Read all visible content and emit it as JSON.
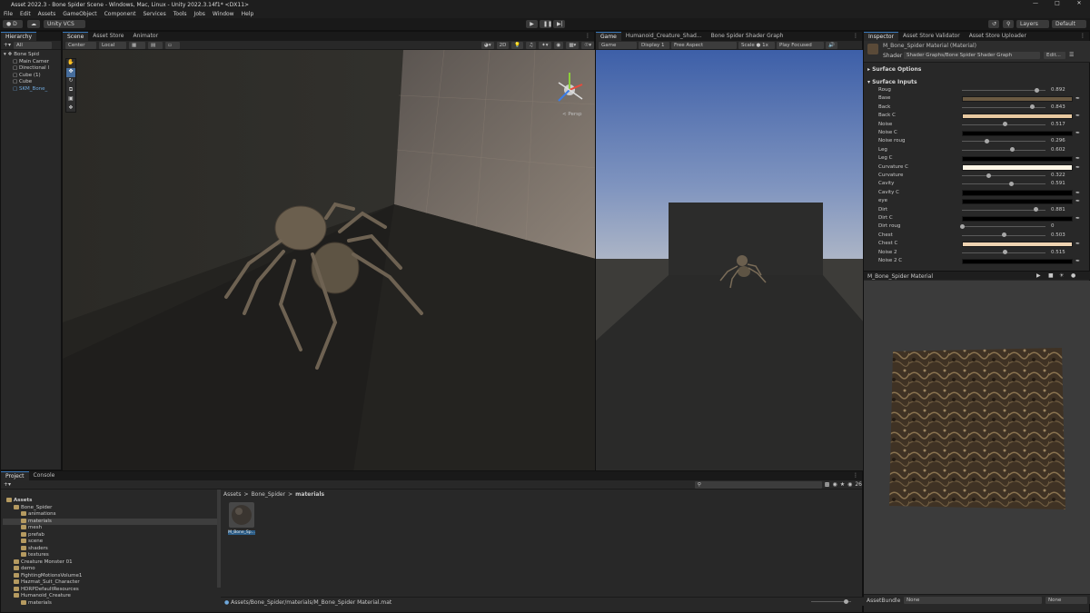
{
  "window": {
    "title": "Asset 2022.3 - Bone Spider Scene - Windows, Mac, Linux - Unity 2022.3.14f1* <DX11>"
  },
  "menu": [
    "File",
    "Edit",
    "Assets",
    "GameObject",
    "Component",
    "Services",
    "Tools",
    "Jobs",
    "Window",
    "Help"
  ],
  "toolbar": {
    "account": "D",
    "vcs": "Unity VCS",
    "layers": "Layers",
    "layout": "Default"
  },
  "hierarchy": {
    "tab": "Hierarchy",
    "search": "All",
    "items": [
      {
        "label": "Bone Spid",
        "indent": 0
      },
      {
        "label": "Main Camer",
        "indent": 1
      },
      {
        "label": "Directional l",
        "indent": 1
      },
      {
        "label": "Cube (1)",
        "indent": 1
      },
      {
        "label": "Cube",
        "indent": 1
      },
      {
        "label": "SKM_Bone_",
        "indent": 1
      }
    ]
  },
  "scene": {
    "tabs": [
      "Scene",
      "Asset Store",
      "Animator"
    ],
    "pivot": "Center",
    "space": "Local",
    "persp": "< Persp"
  },
  "game": {
    "tabs": [
      "Game",
      "Humanoid_Creature_Shad...",
      "Bone Spider Shader Graph"
    ],
    "mode": "Game",
    "display": "Display 1",
    "aspect": "Free Aspect",
    "scale_label": "Scale",
    "scale": "1x",
    "play": "Play Focused"
  },
  "inspector": {
    "tabs": [
      "Inspector",
      "Asset Store Validator",
      "Asset Store Uploader"
    ],
    "material_name": "M_Bone_Spider Material (Material)",
    "shader_label": "Shader",
    "shader": "Shader Graphs/Bone Spider Shader Graph",
    "edit": "Edit...",
    "section_options": "Surface Options",
    "section_inputs": "Surface Inputs",
    "props": [
      {
        "label": "Roug",
        "type": "slider",
        "value": "0.892",
        "fraction": 0.892
      },
      {
        "label": "Base",
        "type": "color",
        "color": "#6b5a42"
      },
      {
        "label": "Back",
        "type": "slider",
        "value": "0.843",
        "fraction": 0.843
      },
      {
        "label": "Back C",
        "type": "color",
        "color": "#e8c9a0"
      },
      {
        "label": "Noise",
        "type": "slider",
        "value": "0.517",
        "fraction": 0.517
      },
      {
        "label": "Noise C",
        "type": "color",
        "color": "#000000"
      },
      {
        "label": "Noise roug",
        "type": "slider",
        "value": "0.296",
        "fraction": 0.296
      },
      {
        "label": "Leg",
        "type": "slider",
        "value": "0.602",
        "fraction": 0.602
      },
      {
        "label": "Leg C",
        "type": "color",
        "color": "#000000"
      },
      {
        "label": "Curvature C",
        "type": "color",
        "color": "#fff6e6"
      },
      {
        "label": "Curvature",
        "type": "slider",
        "value": "0.322",
        "fraction": 0.322
      },
      {
        "label": "Cavity",
        "type": "slider",
        "value": "0.591",
        "fraction": 0.591
      },
      {
        "label": "Cavity C",
        "type": "color",
        "color": "#000000"
      },
      {
        "label": "eye",
        "type": "color",
        "color": "#000000"
      },
      {
        "label": "Dirt",
        "type": "slider",
        "value": "0.881",
        "fraction": 0.881
      },
      {
        "label": "Dirt C",
        "type": "color",
        "color": "#000000"
      },
      {
        "label": "Dirt roug",
        "type": "slider",
        "value": "0",
        "fraction": 0
      },
      {
        "label": "Chest",
        "type": "slider",
        "value": "0.503",
        "fraction": 0.503
      },
      {
        "label": "Chest C",
        "type": "color",
        "color": "#efd4b2"
      },
      {
        "label": "Noise 2",
        "type": "slider",
        "value": "0.515",
        "fraction": 0.515
      },
      {
        "label": "Noise 2 C",
        "type": "color",
        "color": "#000000"
      }
    ],
    "preview_title": "M_Bone_Spider Material",
    "assetbundle_label": "AssetBundle",
    "assetbundle": "None",
    "variant": "None"
  },
  "project": {
    "tabs": [
      "Project",
      "Console"
    ],
    "tree": [
      {
        "label": "Assets",
        "indent": 0,
        "bold": true
      },
      {
        "label": "Bone_Spider",
        "indent": 1
      },
      {
        "label": "animations",
        "indent": 2
      },
      {
        "label": "materials",
        "indent": 2,
        "selected": true
      },
      {
        "label": "mesh",
        "indent": 2
      },
      {
        "label": "prefab",
        "indent": 2
      },
      {
        "label": "scene",
        "indent": 2
      },
      {
        "label": "shaders",
        "indent": 2
      },
      {
        "label": "textures",
        "indent": 2
      },
      {
        "label": "Creature Monster 01",
        "indent": 1
      },
      {
        "label": "demo",
        "indent": 1
      },
      {
        "label": "FightingMotionsVolume1",
        "indent": 1
      },
      {
        "label": "Hazmat_Suit_Character",
        "indent": 1
      },
      {
        "label": "HDRPDefaultResources",
        "indent": 1
      },
      {
        "label": "Humanoid_Creature",
        "indent": 1
      },
      {
        "label": "materials",
        "indent": 2
      }
    ],
    "breadcrumb": [
      "Assets",
      "Bone_Spider",
      "materials"
    ],
    "asset_label": "M_Bone_Sp...",
    "hidden_count": "26",
    "path": "Assets/Bone_Spider/materials/M_Bone_Spider Material.mat"
  }
}
